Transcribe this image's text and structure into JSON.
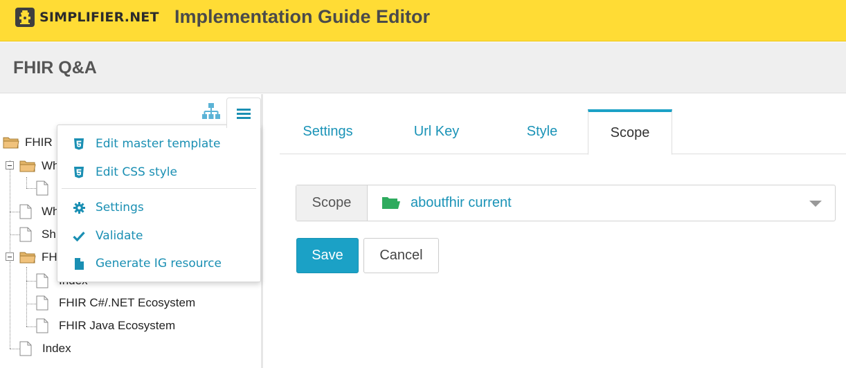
{
  "header": {
    "logo_text": "SIMPLIFIER.NET",
    "app_title": "Implementation Guide Editor",
    "bar_color": "#ffdc35"
  },
  "project": {
    "title": "FHIR Q&A"
  },
  "toolbar": {
    "tree_icon": "sitemap-icon",
    "menu_icon": "hamburger-icon"
  },
  "menu": {
    "items": [
      {
        "label": "Edit master template",
        "icon": "html5-icon"
      },
      {
        "label": "Edit CSS style",
        "icon": "css3-icon"
      },
      {
        "label": "Settings",
        "icon": "gear-icon"
      },
      {
        "label": "Validate",
        "icon": "check-icon"
      },
      {
        "label": "Generate IG resource",
        "icon": "file-icon"
      }
    ]
  },
  "tree": {
    "nodes": [
      {
        "label": "FHIR",
        "type": "folder"
      },
      {
        "label": "Wh",
        "type": "folder"
      },
      {
        "label": "",
        "type": "page"
      },
      {
        "label": "Wh",
        "type": "page"
      },
      {
        "label": "Sh",
        "type": "page"
      },
      {
        "label": "FH",
        "type": "folder"
      },
      {
        "label": "Index",
        "type": "page"
      },
      {
        "label": "FHIR C#/.NET Ecosystem",
        "type": "page"
      },
      {
        "label": "FHIR Java Ecosystem",
        "type": "page"
      },
      {
        "label": "Index",
        "type": "page"
      }
    ]
  },
  "tabs": [
    {
      "label": "Settings",
      "active": false
    },
    {
      "label": "Url Key",
      "active": false
    },
    {
      "label": "Style",
      "active": false
    },
    {
      "label": "Scope",
      "active": true
    }
  ],
  "scope": {
    "label": "Scope",
    "value": "aboutfhir current"
  },
  "actions": {
    "save": "Save",
    "cancel": "Cancel"
  },
  "colors": {
    "accent": "#1ba1c6",
    "link": "#1a93b7",
    "folder_open": "#2eab5e"
  }
}
